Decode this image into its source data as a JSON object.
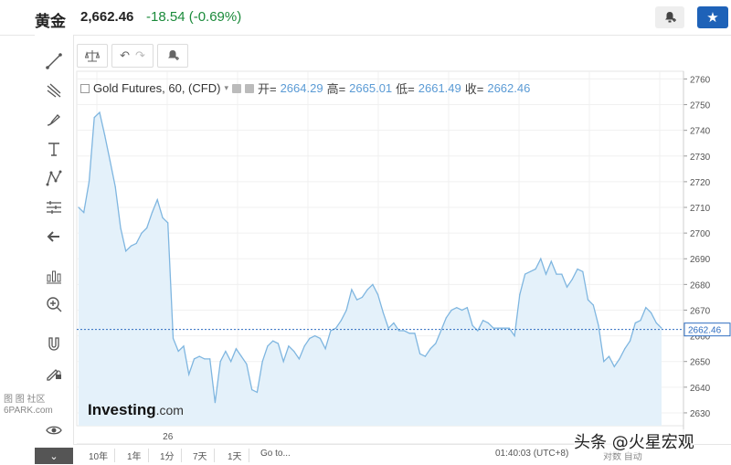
{
  "header": {
    "title": "黄金",
    "price": "2,662.46",
    "change": "-18.54",
    "change_pct": "(-0.69%)",
    "change_color": "#1a8a3a",
    "alert_icon": "bell-plus-icon",
    "star_icon": "star-icon",
    "accent": "#1e62b8"
  },
  "legend": {
    "symbol": "Gold Futures, 60, (CFD)",
    "open_label": "开=",
    "open": "2664.29",
    "high_label": "高=",
    "high": "2665.01",
    "low_label": "低=",
    "low": "2661.49",
    "close_label": "收=",
    "close": "2662.46"
  },
  "chart_toolbar": [
    "scale-icon",
    "undo-icon",
    "redo-icon",
    "alert-add-icon"
  ],
  "left_tools": [
    "trend-line-icon",
    "fib-icon",
    "brush-icon",
    "text-icon",
    "pattern-icon",
    "measure-icon",
    "back-arrow-icon",
    "indicators-icon",
    "zoom-in-icon",
    "magnet-icon",
    "lock-draw-icon",
    "eye-icon"
  ],
  "left_watermark": "图 图 社区\n6PARK.com",
  "bottom": {
    "ranges": [
      "10年",
      "1年",
      "1分",
      "7天",
      "1天",
      "Go to..."
    ],
    "clock": "01:40:03 (UTC+8)",
    "extra": "对数 自动"
  },
  "logo": {
    "main": "Investing",
    "suffix": ".com"
  },
  "watermark": "头条 @火星宏观",
  "chart_data": {
    "type": "area",
    "title": "Gold Futures, 60, (CFD)",
    "ylim": [
      2625,
      2763
    ],
    "yticks": [
      2630,
      2640,
      2650,
      2660,
      2670,
      2680,
      2690,
      2700,
      2710,
      2720,
      2730,
      2740,
      2750,
      2760
    ],
    "xtick_labels": [
      {
        "label": "26",
        "index": 17
      }
    ],
    "last_price": 2662.46,
    "line_color": "#7fb6e0",
    "fill_color": "#e4f1fa",
    "values": [
      2710,
      2708,
      2720,
      2745,
      2747,
      2738,
      2728,
      2718,
      2702,
      2693,
      2695,
      2696,
      2700,
      2702,
      2708,
      2713,
      2706,
      2704,
      2659,
      2654,
      2656,
      2645,
      2651,
      2652,
      2651,
      2651,
      2634,
      2650,
      2654,
      2650,
      2655,
      2652,
      2649,
      2639,
      2638,
      2650,
      2656,
      2658,
      2657,
      2650,
      2656,
      2654,
      2651,
      2656,
      2659,
      2660,
      2659,
      2655,
      2662,
      2663,
      2666,
      2670,
      2678,
      2674,
      2675,
      2678,
      2680,
      2676,
      2669,
      2663,
      2665,
      2662,
      2662,
      2661,
      2661,
      2653,
      2652,
      2655,
      2657,
      2662,
      2667,
      2670,
      2671,
      2670,
      2671,
      2664,
      2662,
      2666,
      2665,
      2663,
      2663,
      2663,
      2663,
      2660,
      2676,
      2684,
      2685,
      2686,
      2690,
      2684,
      2689,
      2684,
      2684,
      2679,
      2682,
      2686,
      2685,
      2674,
      2672,
      2664,
      2650,
      2652,
      2648,
      2651,
      2655,
      2658,
      2665,
      2666,
      2671,
      2669,
      2665,
      2663
    ]
  }
}
